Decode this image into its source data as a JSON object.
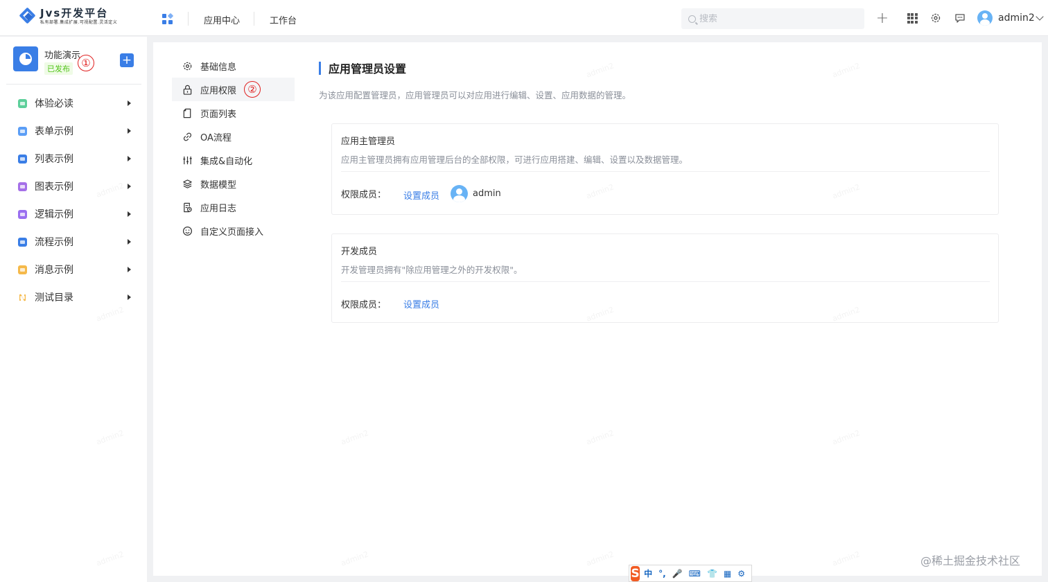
{
  "logo": {
    "title": "Jvs开发平台",
    "subtitle": "私有部署.集成扩展.可视配置.灵活定义"
  },
  "topnav": {
    "items": [
      "应用中心",
      "工作台"
    ]
  },
  "search": {
    "placeholder": "搜索"
  },
  "user": {
    "name": "admin2"
  },
  "sidebar": {
    "app_name": "功能演示",
    "app_status": "已发布",
    "annotation": "①",
    "items": [
      {
        "label": "体验必读",
        "color": "#5dcf9a"
      },
      {
        "label": "表单示例",
        "color": "#5b9ef6"
      },
      {
        "label": "列表示例",
        "color": "#3a7ee6"
      },
      {
        "label": "图表示例",
        "color": "#a570e8"
      },
      {
        "label": "逻辑示例",
        "color": "#9a6ff0"
      },
      {
        "label": "流程示例",
        "color": "#3a7ee6"
      },
      {
        "label": "消息示例",
        "color": "#f5b94a"
      },
      {
        "label": "测试目录",
        "color": "#f5b94a"
      }
    ]
  },
  "submenu": {
    "annotation": "②",
    "items": [
      {
        "label": "基础信息",
        "icon": "gear-icon"
      },
      {
        "label": "应用权限",
        "icon": "lock-icon"
      },
      {
        "label": "页面列表",
        "icon": "page-icon"
      },
      {
        "label": "OA流程",
        "icon": "link-icon"
      },
      {
        "label": "集成&自动化",
        "icon": "sliders-icon"
      },
      {
        "label": "数据模型",
        "icon": "layers-icon"
      },
      {
        "label": "应用日志",
        "icon": "log-icon"
      },
      {
        "label": "自定义页面接入",
        "icon": "smile-icon"
      }
    ]
  },
  "main": {
    "title": "应用管理员设置",
    "description": "为该应用配置管理员，应用管理员可以对应用进行编辑、设置、应用数据的管理。",
    "cards": [
      {
        "title": "应用主管理员",
        "description": "应用主管理员拥有应用管理后台的全部权限，可进行应用搭建、编辑、设置以及数据管理。",
        "perm_label": "权限成员：",
        "link": "设置成员",
        "member": "admin"
      },
      {
        "title": "开发成员",
        "description": "开发管理员拥有\"除应用管理之外的开发权限\"。",
        "perm_label": "权限成员：",
        "link": "设置成员"
      }
    ]
  },
  "ime": {
    "logo": "S",
    "items": [
      "中",
      "°,",
      "🎤",
      "⌨",
      "👕",
      "▦",
      "⚙"
    ]
  },
  "watermark": "admin2",
  "credit": "@稀土掘金技术社区",
  "colors": {
    "accent": "#3a7ee6",
    "published": "#52c41a",
    "annotation": "#e02020"
  }
}
